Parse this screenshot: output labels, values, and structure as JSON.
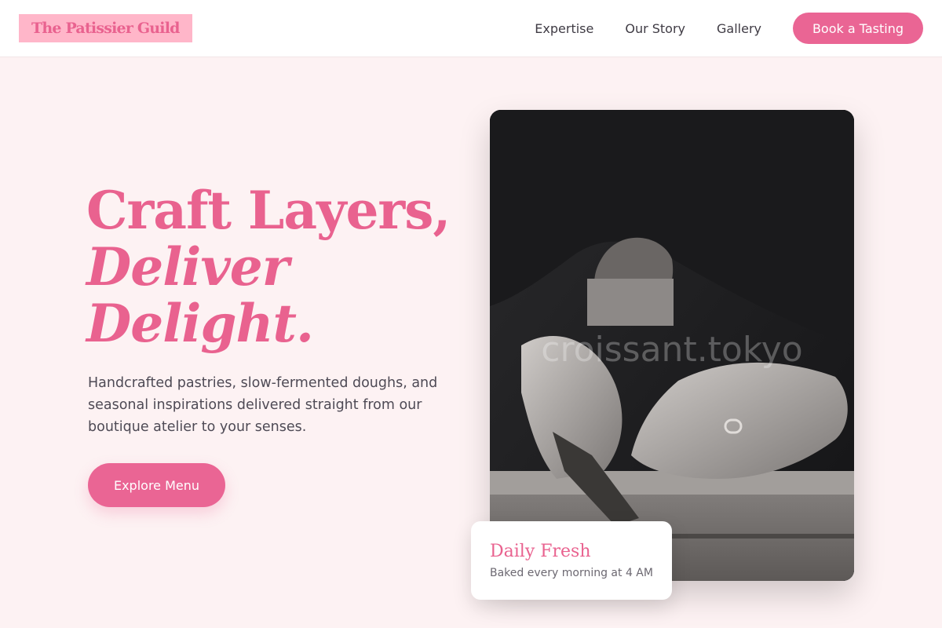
{
  "header": {
    "logo": "The Patissier Guild",
    "nav": [
      "Expertise",
      "Our Story",
      "Gallery"
    ],
    "cta": "Book a Tasting"
  },
  "hero": {
    "title_line1": "Craft Layers,",
    "title_line2": "Deliver",
    "title_line3": "Delight.",
    "description": "Handcrafted pastries, slow-fermented doughs, and seasonal inspirations delivered straight from our boutique atelier to your senses.",
    "button": "Explore Menu"
  },
  "image": {
    "watermark": "croissant.tokyo"
  },
  "badge_card": {
    "title": "Daily Fresh",
    "subtitle": "Baked every morning at 4 AM"
  },
  "colors": {
    "accent": "#ea6594",
    "background": "#fdf2f3",
    "logo_bg": "#ffb6c9"
  }
}
